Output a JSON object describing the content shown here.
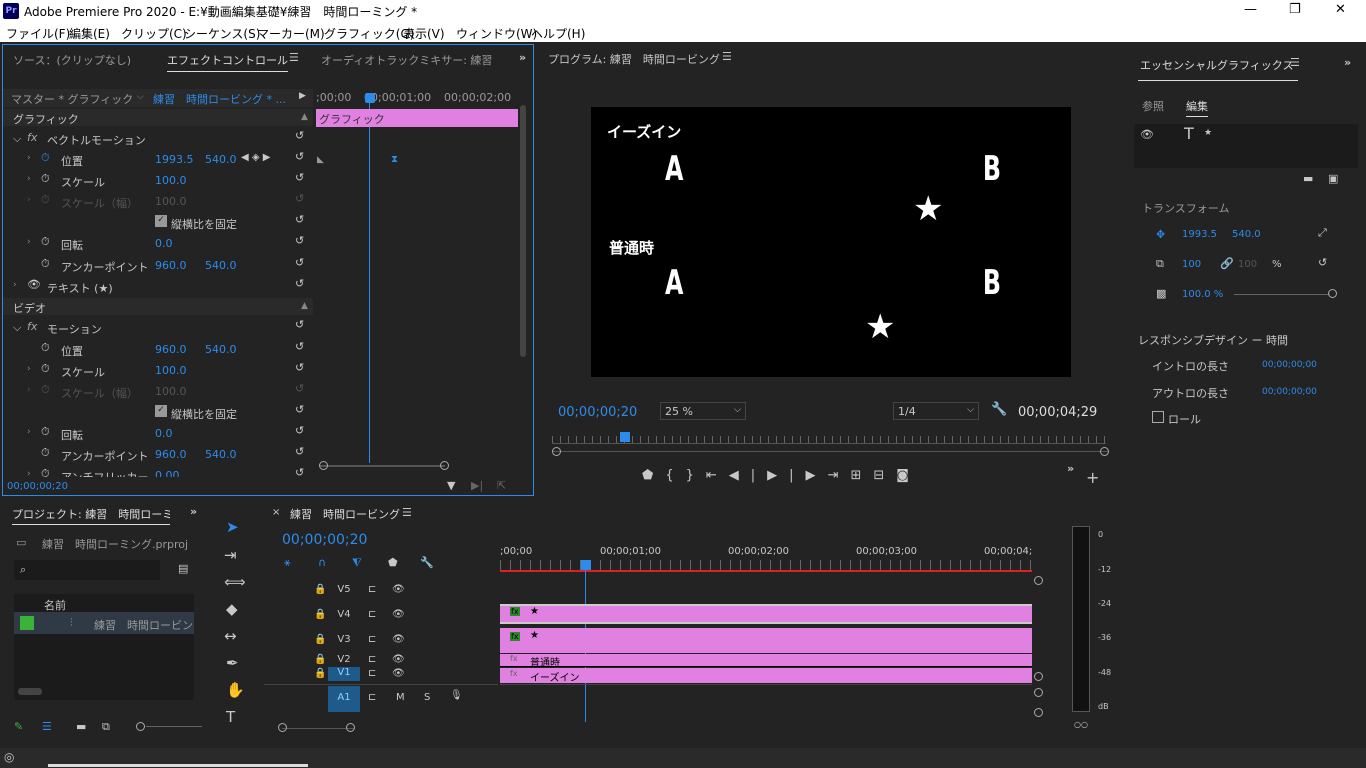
{
  "app": {
    "title": "Adobe Premiere Pro 2020 - E:¥動画編集基礎¥練習　時間ローミング *",
    "icon": "Pr"
  },
  "menu": [
    "ファイル(F)",
    "編集(E)",
    "クリップ(C)",
    "シーケンス(S)",
    "マーカー(M)",
    "グラフィック(G)",
    "表示(V)",
    "ウィンドウ(W)",
    "ヘルプ(H)"
  ],
  "effect_panel": {
    "tabs": [
      "ソース：(クリップなし)",
      "エフェクトコントロール",
      "オーディオトラックミキサー: 練習"
    ],
    "master_label": "マスター * グラフィック",
    "seq_label": "練習　時間ロービング * ...",
    "ruler": [
      ";00;00",
      "00;00;01;00",
      "00;00;02;00"
    ],
    "clip_label": "グラフィック",
    "section_graphic": "グラフィック",
    "vector_motion": "ベクトルモーション",
    "rows": [
      {
        "label": "位置",
        "v1": "1993.5",
        "v2": "540.0"
      },
      {
        "label": "スケール",
        "v1": "100.0"
      },
      {
        "label": "スケール（幅）",
        "v1": "100.0"
      },
      {
        "label": "縦横比を固定"
      },
      {
        "label": "回転",
        "v1": "0.0"
      },
      {
        "label": "アンカーポイント",
        "v1": "960.0",
        "v2": "540.0"
      }
    ],
    "text_layer": "テキスト (★)",
    "section_video": "ビデオ",
    "motion": "モーション",
    "rows2": [
      {
        "label": "位置",
        "v1": "960.0",
        "v2": "540.0"
      },
      {
        "label": "スケール",
        "v1": "100.0"
      },
      {
        "label": "スケール（幅）",
        "v1": "100.0"
      },
      {
        "label": "縦横比を固定"
      },
      {
        "label": "回転",
        "v1": "0.0"
      },
      {
        "label": "アンカーポイント",
        "v1": "960.0",
        "v2": "540.0"
      },
      {
        "label": "アンチフリッカー",
        "v1": "0.00"
      }
    ],
    "timecode": "00;00;00;20"
  },
  "program": {
    "title": "プログラム: 練習　時間ロービング",
    "text_ease": "イーズイン",
    "text_normal": "普通時",
    "A": "A",
    "B": "B",
    "star": "★",
    "timecode": "00;00;00;20",
    "zoom": "25 %",
    "quality": "1/4",
    "duration": "00;00;04;29"
  },
  "essential": {
    "title": "エッセンシャルグラフィックス",
    "tab_browse": "参照",
    "tab_edit": "編集",
    "transform": "トランスフォーム",
    "pos1": "1993.5",
    "pos2": "540.0",
    "scale": "100",
    "scale2": "100",
    "pct": "%",
    "opacity": "100.0 %",
    "responsive": "レスポンシブデザイン ー 時間",
    "intro": "イントロの長さ",
    "intro_val": "00;00;00;00",
    "outro": "アウトロの長さ",
    "outro_val": "00;00;00;00",
    "roll": "ロール"
  },
  "project": {
    "title": "プロジェクト: 練習　時間ローミ",
    "file": "練習　時間ローミング.prproj",
    "col_name": "名前",
    "item": "練習　時間ロービング"
  },
  "timeline": {
    "title": "練習　時間ロービング",
    "timecode": "00;00;00;20",
    "ruler": [
      ";00;00",
      "00;00;01;00",
      "00;00;02;00",
      "00;00;03;00",
      "00;00;04;"
    ],
    "tracks": [
      "V5",
      "V4",
      "V3",
      "V2",
      "V1",
      "A1"
    ],
    "clip_v4": "★",
    "clip_v3": "★",
    "clip_v2": "普通時",
    "clip_v1": "イーズイン",
    "m": "M",
    "s": "S"
  },
  "meter": {
    "labels": [
      "0",
      "-12",
      "-24",
      "-36",
      "-48",
      "dB"
    ]
  }
}
